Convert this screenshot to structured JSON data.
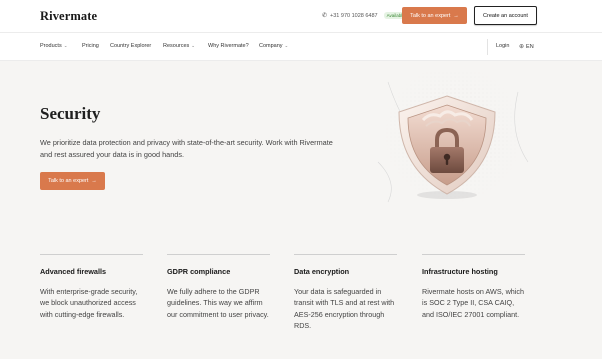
{
  "header": {
    "logo": "Rivermate",
    "phone": "+31 970 1028 6487",
    "availability": "Available",
    "talk_button": "Talk to an expert",
    "create_button": "Create an account"
  },
  "nav": {
    "items": [
      {
        "label": "Products",
        "dropdown": true
      },
      {
        "label": "Pricing",
        "dropdown": false
      },
      {
        "label": "Country Explorer",
        "dropdown": false
      },
      {
        "label": "Resources",
        "dropdown": true
      },
      {
        "label": "Why Rivermate?",
        "dropdown": false
      },
      {
        "label": "Company",
        "dropdown": true
      }
    ],
    "login": "Login",
    "language": "EN"
  },
  "hero": {
    "title": "Security",
    "description": "We prioritize data protection and privacy with state-of-the-art security. Work with Rivermate and rest assured your data is in good hands.",
    "cta": "Talk to an expert"
  },
  "features": [
    {
      "title": "Advanced firewalls",
      "text": "With enterprise-grade security, we block unauthorized access with cutting-edge firewalls."
    },
    {
      "title": "GDPR compliance",
      "text": "We fully adhere to the GDPR guidelines. This way we affirm our commitment to user privacy."
    },
    {
      "title": "Data encryption",
      "text": "Your data is safeguarded in transit with TLS and at rest with AES-256 encryption through RDS."
    },
    {
      "title": "Infrastructure hosting",
      "text": "Rivermate hosts on AWS, which is SOC 2 Type II, CSA CAIQ, and ISO/IEC 27001 compliant."
    }
  ],
  "colors": {
    "accent": "#d9794c",
    "background": "#f6f5f3",
    "text": "#222222"
  },
  "icons": {
    "phone": "phone-icon",
    "arrow": "arrow-right-icon",
    "chevron": "chevron-down-icon",
    "globe": "globe-icon",
    "hero": "shield-lock-illustration"
  }
}
